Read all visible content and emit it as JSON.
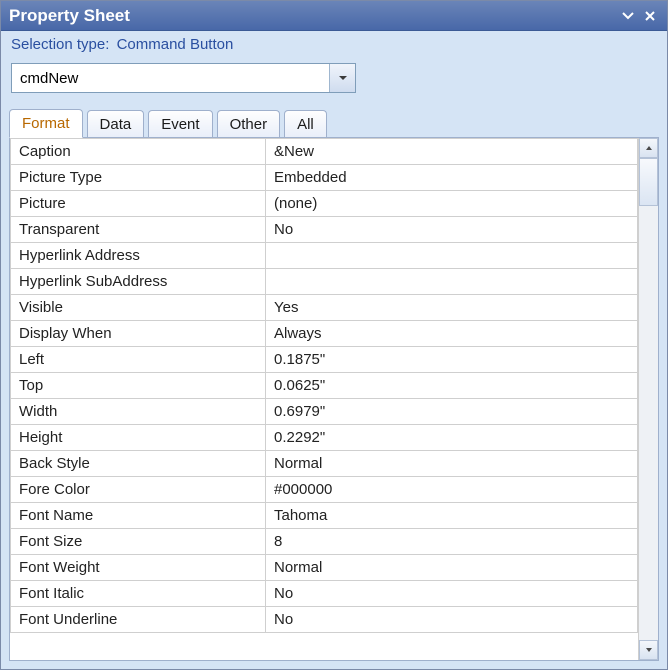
{
  "titlebar": {
    "title": "Property Sheet"
  },
  "selection": {
    "label": "Selection type:",
    "value": "Command Button"
  },
  "selector": {
    "value": "cmdNew"
  },
  "tabs": [
    {
      "label": "Format",
      "active": true
    },
    {
      "label": "Data",
      "active": false
    },
    {
      "label": "Event",
      "active": false
    },
    {
      "label": "Other",
      "active": false
    },
    {
      "label": "All",
      "active": false
    }
  ],
  "properties": [
    {
      "name": "Caption",
      "value": "&New"
    },
    {
      "name": "Picture Type",
      "value": "Embedded"
    },
    {
      "name": "Picture",
      "value": "(none)"
    },
    {
      "name": "Transparent",
      "value": "No"
    },
    {
      "name": "Hyperlink Address",
      "value": ""
    },
    {
      "name": "Hyperlink SubAddress",
      "value": ""
    },
    {
      "name": "Visible",
      "value": "Yes"
    },
    {
      "name": "Display When",
      "value": "Always"
    },
    {
      "name": "Left",
      "value": "0.1875\""
    },
    {
      "name": "Top",
      "value": "0.0625\""
    },
    {
      "name": "Width",
      "value": "0.6979\""
    },
    {
      "name": "Height",
      "value": "0.2292\""
    },
    {
      "name": "Back Style",
      "value": "Normal"
    },
    {
      "name": "Fore Color",
      "value": "#000000"
    },
    {
      "name": "Font Name",
      "value": "Tahoma"
    },
    {
      "name": "Font Size",
      "value": "8"
    },
    {
      "name": "Font Weight",
      "value": "Normal"
    },
    {
      "name": "Font Italic",
      "value": "No"
    },
    {
      "name": "Font Underline",
      "value": "No"
    }
  ]
}
